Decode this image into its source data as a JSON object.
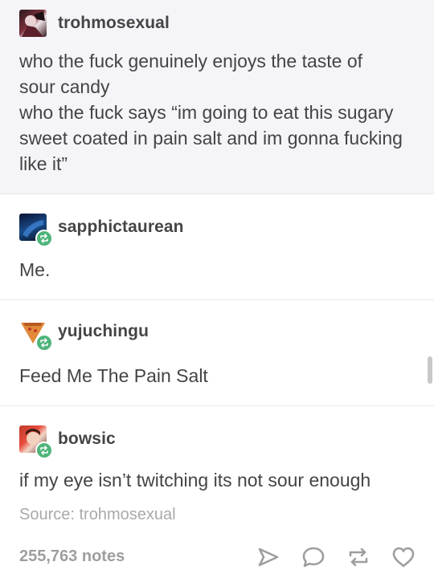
{
  "posts": [
    {
      "username": "trohmosexual",
      "lines": [
        "who the fuck genuinely enjoys the taste of sour candy",
        "who the fuck says “im going to eat this sugary sweet coated in pain salt and im gonna fucking like it”"
      ]
    },
    {
      "username": "sapphictaurean",
      "text": "Me."
    },
    {
      "username": "yujuchingu",
      "text": "Feed Me The Pain Salt"
    },
    {
      "username": "bowsic",
      "text": "if my eye isn’t twitching its not sour enough"
    }
  ],
  "source": "Source: trohmosexual",
  "footer": {
    "notes": "255,763 notes",
    "icons": [
      "share-icon",
      "reply-icon",
      "reblog-icon",
      "like-icon"
    ]
  },
  "colors": {
    "reblog_badge": "#4fb47a",
    "text": "#444444",
    "muted": "#a9a9a9",
    "original_post_bg": "#f5f4f8"
  }
}
